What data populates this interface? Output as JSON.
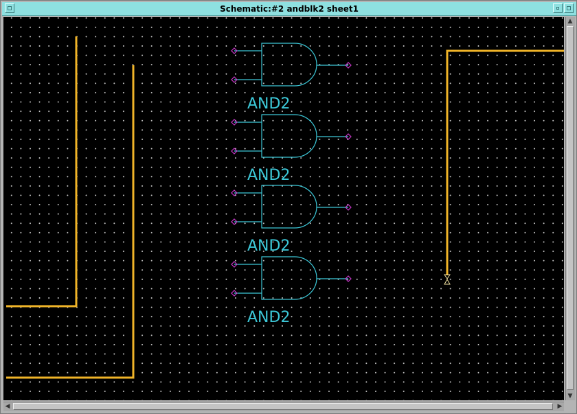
{
  "window": {
    "title": "Schematic:#2 andblk2 sheet1"
  },
  "icons": {
    "window_menu": "window-menu-icon",
    "minimize": "minimize-icon",
    "maximize": "maximize-icon",
    "scroll_up": "arrow-up-icon",
    "scroll_down": "arrow-down-icon",
    "scroll_left": "arrow-left-icon",
    "scroll_right": "arrow-right-icon"
  },
  "colors": {
    "canvas": "#000000",
    "grid_dot": "#c8c8c8",
    "gate": "#3cc8d8",
    "pin": "#c838c8",
    "bus": "#f0b428",
    "titlebar": "#8ee0e0"
  },
  "schematic": {
    "gates": [
      {
        "label": "AND2"
      },
      {
        "label": "AND2"
      },
      {
        "label": "AND2"
      },
      {
        "label": "AND2"
      }
    ]
  }
}
